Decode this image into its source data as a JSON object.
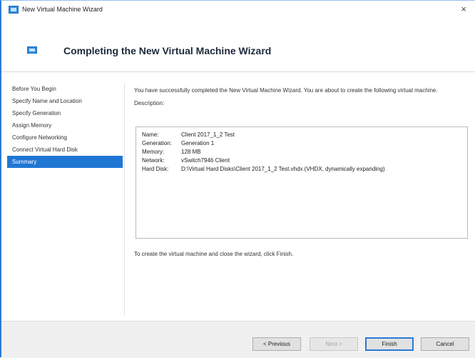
{
  "window": {
    "title": "New Virtual Machine Wizard",
    "close_glyph": "×"
  },
  "header": {
    "heading": "Completing the New Virtual Machine Wizard"
  },
  "sidebar": {
    "steps": [
      {
        "label": "Before You Begin",
        "active": false
      },
      {
        "label": "Specify Name and Location",
        "active": false
      },
      {
        "label": "Specify Generation",
        "active": false
      },
      {
        "label": "Assign Memory",
        "active": false
      },
      {
        "label": "Configure Networking",
        "active": false
      },
      {
        "label": "Connect Virtual Hard Disk",
        "active": false
      },
      {
        "label": "Summary",
        "active": true
      }
    ]
  },
  "main": {
    "intro": "You have successfully completed the New Virtual Machine Wizard. You are about to create the following virtual machine.",
    "description_label": "Description:",
    "summary": [
      {
        "key": "Name:",
        "value": "Client 2017_1_2 Test"
      },
      {
        "key": "Generation:",
        "value": "Generation 1"
      },
      {
        "key": "Memory:",
        "value": "128 MB"
      },
      {
        "key": "Network:",
        "value": "vSwitch7946 Client"
      },
      {
        "key": "Hard Disk:",
        "value": "D:\\Virtual Hard Disks\\Client 2017_1_2 Test.vhdx (VHDX, dynamically expanding)"
      }
    ],
    "finish_note": "To create the virtual machine and close the wizard, click Finish."
  },
  "buttons": {
    "previous": "< Previous",
    "next": "Next >",
    "finish": "Finish",
    "cancel": "Cancel"
  },
  "colors": {
    "accent": "#1f77d4",
    "window_border": "#2d7bd6"
  }
}
